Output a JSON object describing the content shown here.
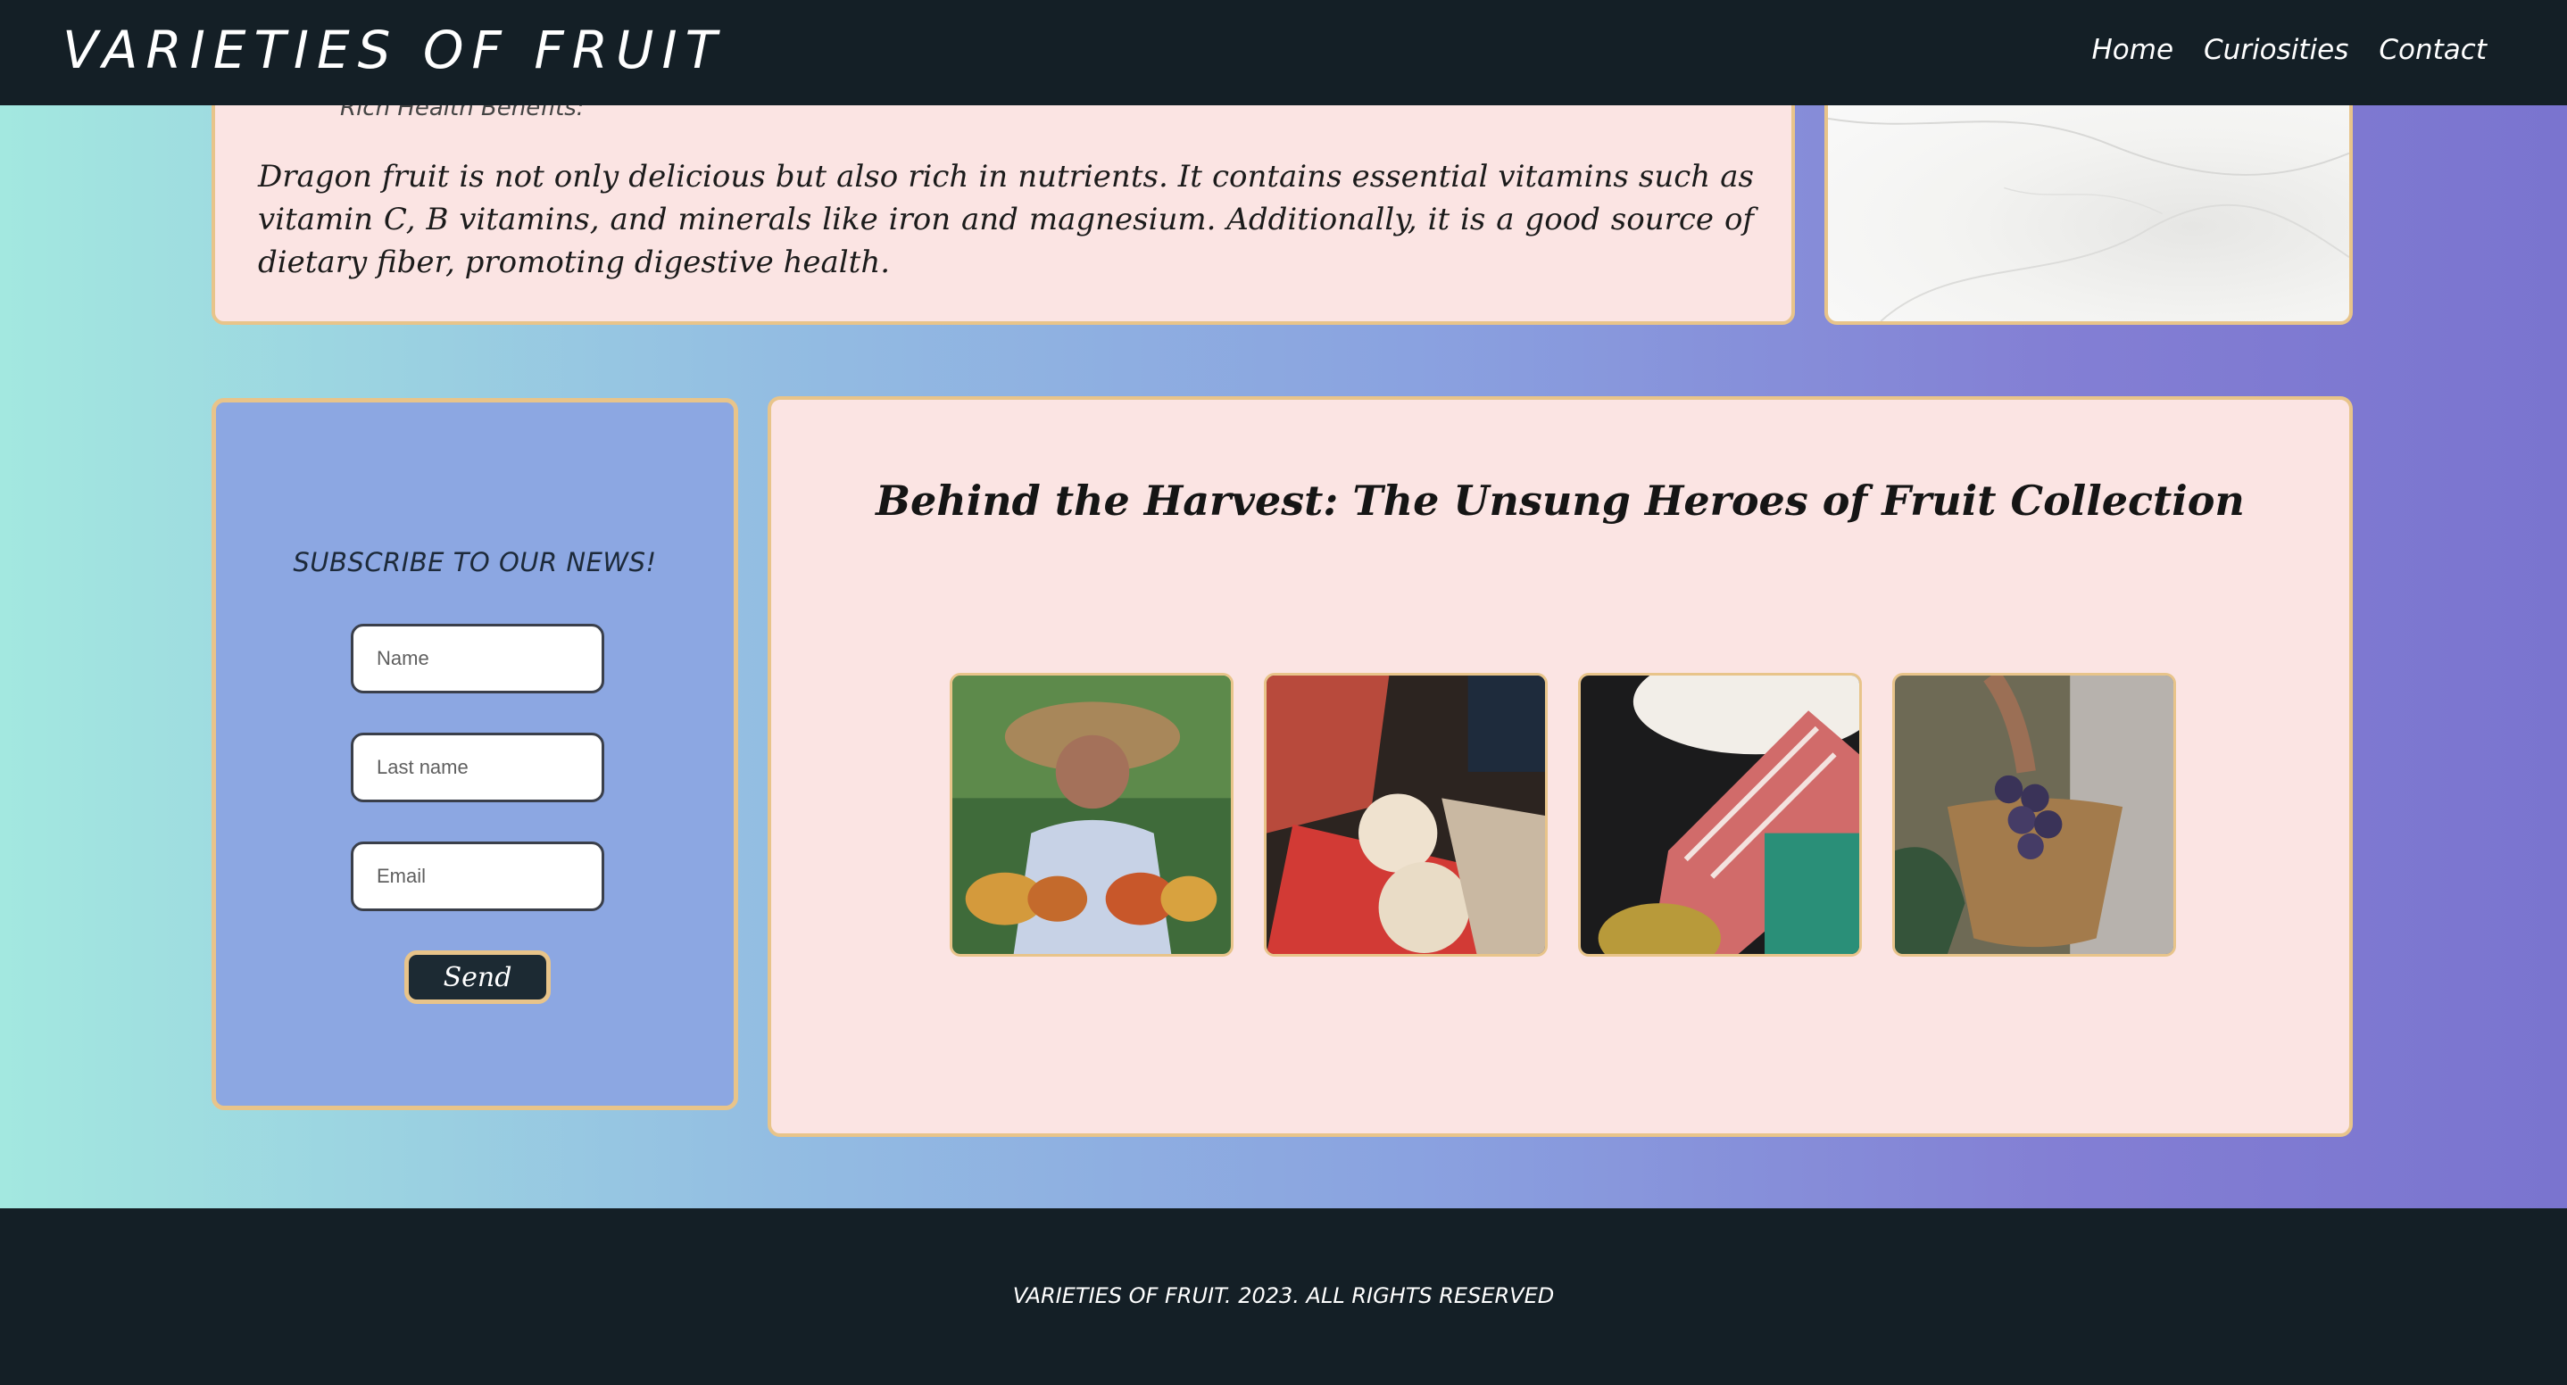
{
  "header": {
    "brand": "VARIETIES OF FRUIT",
    "nav": [
      "Home",
      "Curiosities",
      "Contact"
    ]
  },
  "info": {
    "clipped_line": "Rich Health Benefits:",
    "paragraph": "Dragon fruit is not only delicious but also rich in nutrients. It contains essential vitamins such as vitamin C, B vitamins, and minerals like iron and magnesium. Additionally, it is a good source of dietary fiber, promoting digestive health."
  },
  "subscribe": {
    "title": "SUBSCRIBE TO OUR NEWS!",
    "name_placeholder": "Name",
    "lastname_placeholder": "Last name",
    "email_placeholder": "Email",
    "send_label": "Send"
  },
  "harvest": {
    "title": "Behind the Harvest: The Unsung Heroes of Fruit Collection",
    "photos": [
      "woman-holding-papayas",
      "hands-cutting-coconut",
      "durian-on-market-table",
      "basket-of-grapes"
    ]
  },
  "footer": {
    "text": "VARIETIES OF FRUIT. 2023. ALL RIGHTS RESERVED"
  },
  "colors": {
    "dark": "#141f26",
    "card_pink": "#fbe4e3",
    "card_blue": "#8ca7e2",
    "border_gold": "#e8c48a"
  }
}
